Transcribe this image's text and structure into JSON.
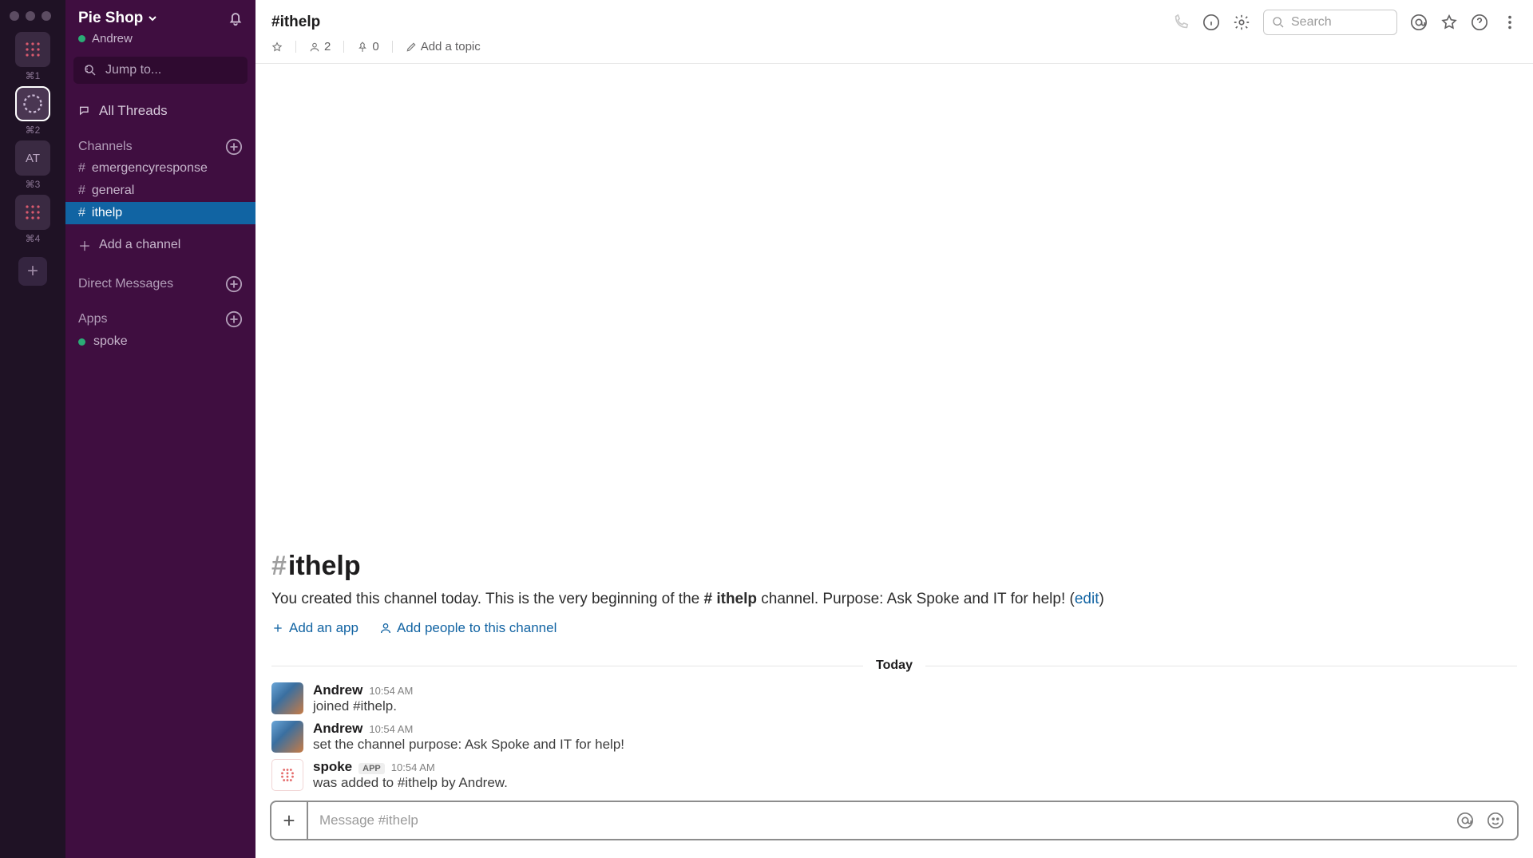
{
  "workspace_bar": {
    "shortcuts": [
      "⌘1",
      "⌘2",
      "⌘3",
      "⌘4"
    ],
    "avatar_text": "AT"
  },
  "sidebar": {
    "team_name": "Pie Shop",
    "user": "Andrew",
    "jump_label": "Jump to...",
    "all_threads": "All Threads",
    "channels_header": "Channels",
    "channels": [
      {
        "name": "emergencyresponse",
        "active": false
      },
      {
        "name": "general",
        "active": false
      },
      {
        "name": "ithelp",
        "active": true
      }
    ],
    "add_channel": "Add a channel",
    "dm_header": "Direct Messages",
    "apps_header": "Apps",
    "apps": [
      {
        "name": "spoke"
      }
    ]
  },
  "header": {
    "channel": "#ithelp",
    "members": "2",
    "pins": "0",
    "add_topic": "Add a topic",
    "search_placeholder": "Search"
  },
  "intro": {
    "hash": "#",
    "name": "ithelp",
    "desc_pre": "You created this channel today. This is the very beginning of the ",
    "desc_chan": "# ithelp",
    "desc_mid": " channel. Purpose: Ask Spoke and IT for help! (",
    "edit": "edit",
    "desc_post": ")",
    "add_app": "Add an app",
    "add_people": "Add people to this channel"
  },
  "day_separator": "Today",
  "messages": [
    {
      "name": "Andrew",
      "time": "10:54 AM",
      "text": "joined #ithelp.",
      "app": false
    },
    {
      "name": "Andrew",
      "time": "10:54 AM",
      "text": "set the channel purpose: Ask Spoke and IT for help!",
      "app": false
    },
    {
      "name": "spoke",
      "time": "10:54 AM",
      "text": "was added to #ithelp by Andrew.",
      "app": true,
      "badge": "APP"
    }
  ],
  "composer": {
    "placeholder": "Message #ithelp"
  }
}
